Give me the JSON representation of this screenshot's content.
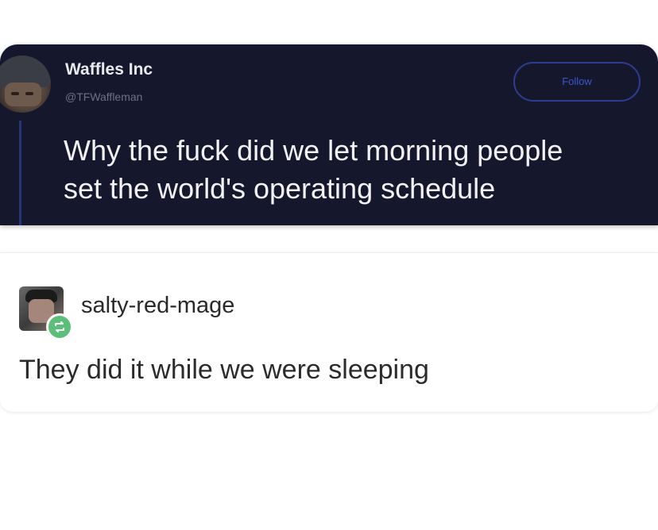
{
  "tweet": {
    "display_name": "Waffles Inc",
    "handle": "@TFWaffleman",
    "follow_label": "Follow",
    "text": "Why the fuck did we let morning people\nset the world's operating schedule",
    "avatar_icon": "profile-avatar",
    "background_color": "#15182c",
    "accent_color": "#2d3c8f"
  },
  "reply": {
    "username": "salty-red-mage",
    "text": "They did it while we were sleeping",
    "avatar_icon": "profile-avatar",
    "badge_icon": "reblog-icon",
    "badge_color": "#5bbf7a"
  }
}
